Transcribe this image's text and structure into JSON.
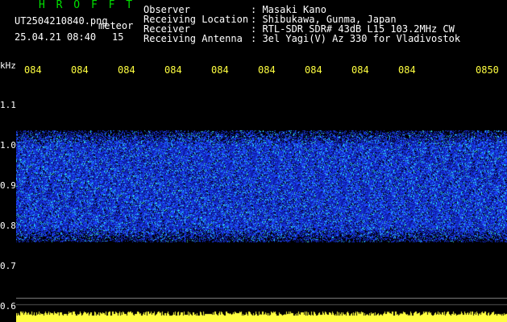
{
  "header": {
    "title": "H R O F F T",
    "filename": "UT2504210840.png",
    "mode": "meteor",
    "datetime": "25.04.21 08:40",
    "count": "15"
  },
  "info": [
    {
      "label": "Observer",
      "value": ": Masaki Kano"
    },
    {
      "label": "Receiving Location",
      "value": ": Shibukawa, Gunma, Japan"
    },
    {
      "label": "Receiver",
      "value": ": RTL-SDR SDR# 43dB L15 103.2MHz CW"
    },
    {
      "label": "Receiving Antenna",
      "value": ": 3el Yagi(V) Az 330 for Vladivostok"
    }
  ],
  "axis": {
    "unit": "kHz",
    "y_ticks": [
      "1.1",
      "1.0",
      "0.9",
      "0.8",
      "0.7",
      "0.6"
    ],
    "x_ticks": [
      "084",
      "084",
      "084",
      "084",
      "084",
      "084",
      "084",
      "084",
      "084",
      "0850"
    ]
  },
  "colors": {
    "background": "#000000",
    "signal_blue": "#1a3cff",
    "noise_cyan": "#27d6ff",
    "marker_yellow": "#ffff40",
    "title_green": "#00e000"
  }
}
